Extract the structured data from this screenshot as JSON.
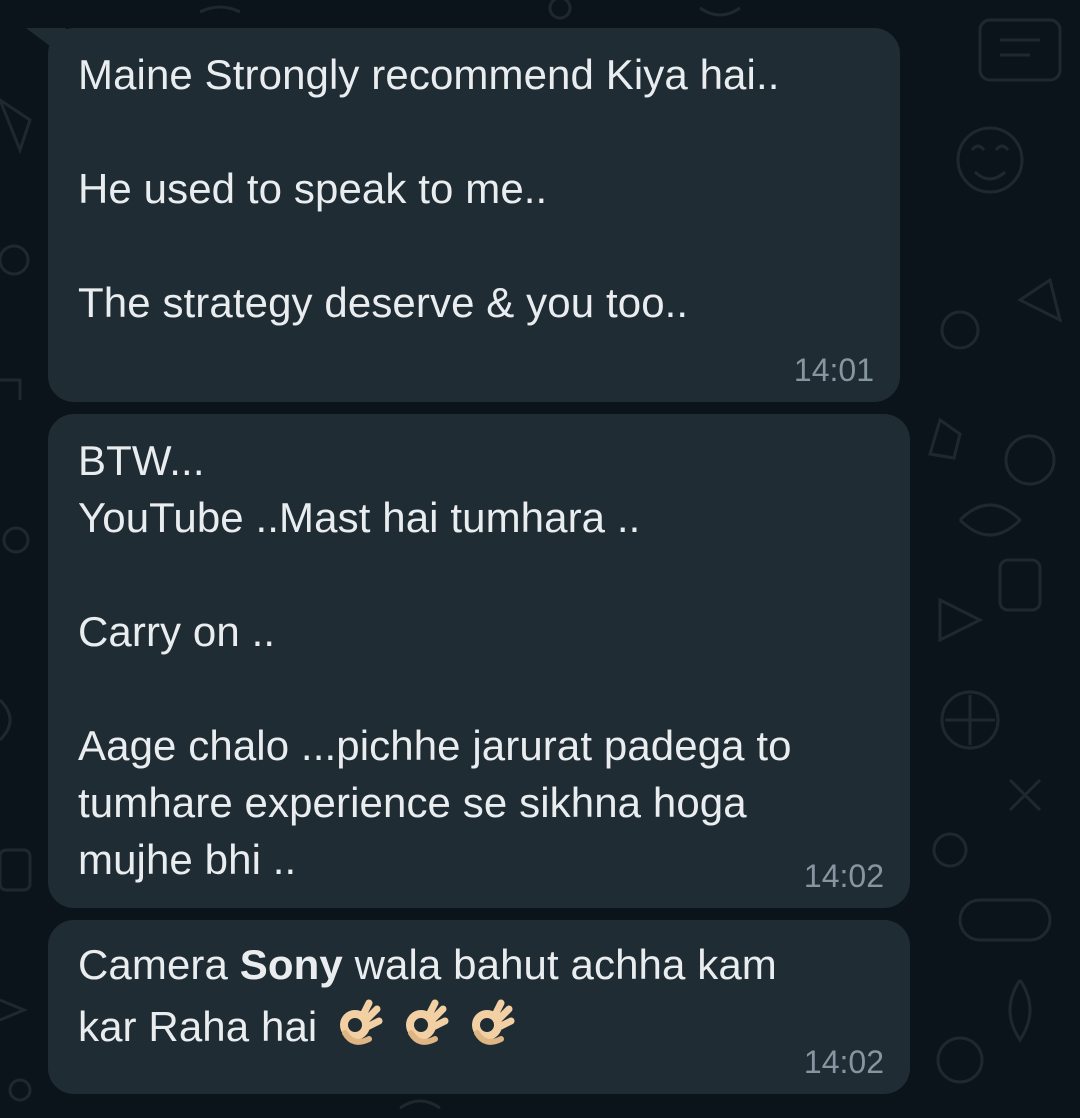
{
  "messages": [
    {
      "lines": [
        "Maine Strongly recommend Kiya hai..",
        "",
        "He used to speak to me..",
        "",
        "The strategy deserve & you too.."
      ],
      "time": "14:01"
    },
    {
      "lines": [
        "BTW...",
        "YouTube ..Mast hai tumhara ..",
        "",
        "Carry on ..",
        "",
        "Aage chalo ...pichhe jarurat padega to",
        "tumhare experience se sikhna hoga",
        "mujhe bhi .."
      ],
      "time": "14:02"
    },
    {
      "line1_before": "Camera ",
      "line1_bold": "Sony",
      "line1_after": " wala bahut achha kam",
      "line2": "kar Raha hai",
      "emojis": [
        "ok-hand-emoji",
        "ok-hand-emoji",
        "ok-hand-emoji"
      ],
      "time": "14:02"
    }
  ],
  "colors": {
    "background": "#0b141a",
    "bubble": "#202c33",
    "text": "#e9edef",
    "timestamp": "#8696a0"
  }
}
